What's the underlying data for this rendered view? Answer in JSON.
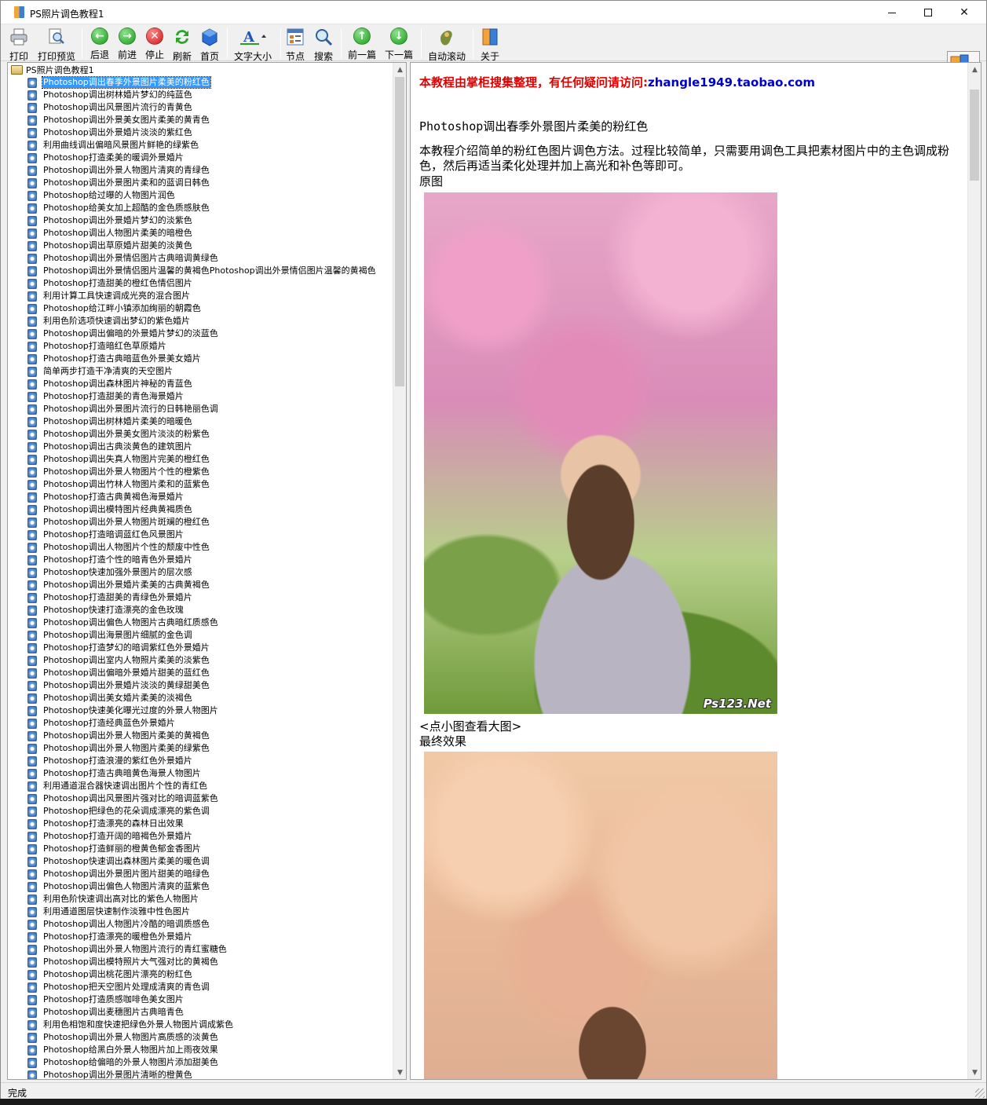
{
  "window": {
    "title": "PS照片调色教程1"
  },
  "toolbar": {
    "print": "打印",
    "print_preview": "打印预览",
    "back": "后退",
    "forward": "前进",
    "stop": "停止",
    "refresh": "刷新",
    "home": "首页",
    "font_size": "文字大小",
    "nodes": "节点",
    "search": "搜索",
    "prev": "前一篇",
    "next": "下一篇",
    "auto_scroll": "自动滚动",
    "about": "关于"
  },
  "tree": {
    "root": "PS照片调色教程1",
    "items": [
      "Photoshop调出春季外景图片柔美的粉红色",
      "Photoshop调出树林婚片梦幻的纯蓝色",
      "Photoshop调出风景图片流行的青黄色",
      "Photoshop调出外景美女图片柔美的黄青色",
      "Photoshop调出外景婚片淡淡的紫红色",
      "利用曲线调出偏暗风景图片鲜艳的绿紫色",
      "Photoshop打造柔美的暖调外景婚片",
      "Photoshop调出外景人物图片清爽的青绿色",
      "Photoshop调出外景图片柔和的蓝调日韩色",
      "Photoshop给过曝的人物图片润色",
      "Photoshop给美女加上超酷的金色质感肤色",
      "Photoshop调出外景婚片梦幻的淡紫色",
      "Photoshop调出人物图片柔美的暗橙色",
      "Photoshop调出草原婚片甜美的淡黄色",
      "Photoshop调出外景情侣图片古典暗调黄绿色",
      "Photoshop调出外景情侣图片温馨的黄褐色Photoshop调出外景情侣图片温馨的黄褐色",
      "Photoshop打造甜美的橙红色情侣图片",
      "利用计算工具快速调成光亮的混合图片",
      "Photoshop给江畔小镇添加绚丽的朝霞色",
      "利用色阶选项快速调出梦幻的紫色婚片",
      "Photoshop调出偏暗的外景婚片梦幻的淡蓝色",
      "Photoshop打造暗红色草原婚片",
      "Photoshop打造古典暗蓝色外景美女婚片",
      "简单两步打造干净清爽的天空图片",
      "Photoshop调出森林图片神秘的青蓝色",
      "Photoshop打造甜美的青色海景婚片",
      "Photoshop调出外景图片流行的日韩艳丽色调",
      "Photoshop调出树林婚片柔美的暗暖色",
      "Photoshop调出外景美女图片淡淡的粉紫色",
      "Photoshop调出古典淡黄色的建筑图片",
      "Photoshop调出失真人物图片完美的橙红色",
      "Photoshop调出外景人物图片个性的橙紫色",
      "Photoshop调出竹林人物图片柔和的蓝紫色",
      "Photoshop打造古典黄褐色海景婚片",
      "Photoshop调出模特图片经典黄褐质色",
      "Photoshop调出外景人物图片斑斓的橙红色",
      "Photoshop打造暗调蓝红色风景图片",
      "Photoshop调出人物图片个性的颓废中性色",
      "Photoshop打造个性的暗青色外景婚片",
      "Photoshop快速加强外景图片的层次感",
      "Photoshop调出外景婚片柔美的古典黄褐色",
      "Photoshop打造甜美的青绿色外景婚片",
      "Photoshop快速打造漂亮的金色玫瑰",
      "Photoshop调出偏色人物图片古典暗红质感色",
      "Photoshop调出海景图片细腻的金色调",
      "Photoshop打造梦幻的暗调紫红色外景婚片",
      "Photoshop调出室内人物照片柔美的淡紫色",
      "Photoshop调出偏暗外景婚片甜美的蓝红色",
      "Photoshop调出外景婚片淡淡的黄绿甜美色",
      "Photoshop调出美女婚片柔美的淡褐色",
      "Photoshop快速美化曝光过度的外景人物图片",
      "Photoshop打造经典蓝色外景婚片",
      "Photoshop调出外景人物图片柔美的黄褐色",
      "Photoshop调出外景人物图片柔美的绿紫色",
      "Photoshop打造浪漫的紫红色外景婚片",
      "Photoshop打造古典暗黄色海景人物图片",
      "利用通道混合器快速调出图片个性的青红色",
      "Photoshop调出风景图片强对比的暗调蓝紫色",
      "Photoshop把绿色的花朵调成漂亮的紫色调",
      "Photoshop打造漂亮的森林日出效果",
      "Photoshop打造开阔的暗褐色外景婚片",
      "Photoshop打造鲜丽的橙黄色郁金香图片",
      "Photoshop快速调出森林图片柔美的暖色调",
      "Photoshop调出外景图片图片甜美的暗绿色",
      "Photoshop调出偏色人物图片清爽的蓝紫色",
      "利用色阶快速调出高对比的紫色人物图片",
      "利用通道图层快速制作淡雅中性色图片",
      "Photoshop调出人物图片冷酷的暗调质感色",
      "Photoshop打造漂亮的暖橙色外景婚片",
      "Photoshop调出外景人物图片流行的青红蜜糖色",
      "Photoshop调出模特照片大气强对比的黄褐色",
      "Photoshop调出桃花图片漂亮的粉红色",
      "Photoshop把天空图片处理成清爽的青色调",
      "Photoshop打造质感咖啡色美女图片",
      "Photoshop调出麦穗图片古典暗青色",
      "利用色相饱和度快速把绿色外景人物图片调成紫色",
      "Photoshop调出外景人物图片高质感的淡黄色",
      "Photoshop给黑白外景人物图片加上雨夜效果",
      "Photoshop给偏暗的外景人物图片添加甜美色",
      "Photoshop调出外景图片清晰的橙黄色"
    ]
  },
  "content": {
    "banner_text": "本教程由掌柜搜集整理，有任何疑问请访问:",
    "banner_link": "zhangle1949.taobao.com",
    "title": "Photoshop调出春季外景图片柔美的粉红色",
    "intro": "本教程介绍简单的粉红色图片调色方法。过程比较简单，只需要用调色工具把素材图片中的主色调成粉色，然后再适当柔化处理并加上高光和补色等即可。",
    "original_label": "原图",
    "click_hint": "<点小图查看大图>",
    "final_label": "最终效果",
    "watermark": "Ps123.Net"
  },
  "status": {
    "text": "完成"
  }
}
